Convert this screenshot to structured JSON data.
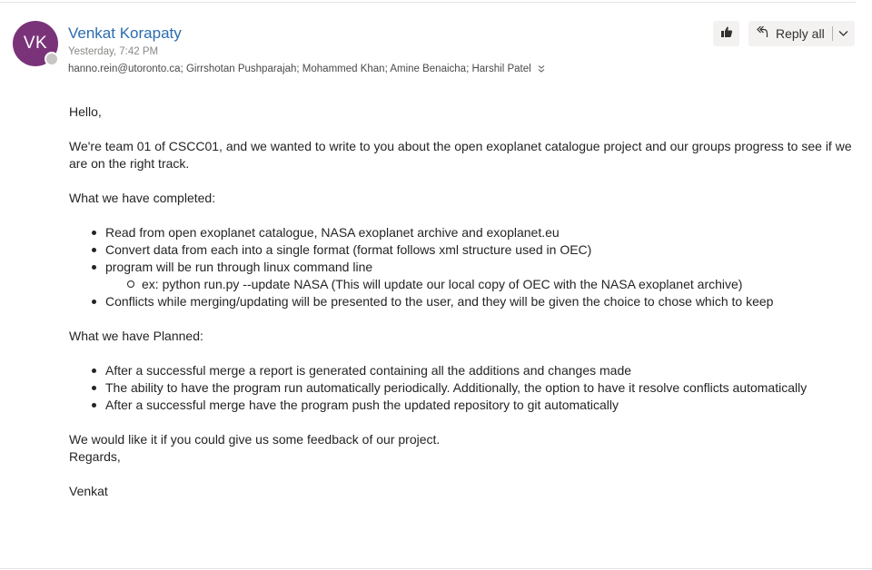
{
  "sender": {
    "initials": "VK",
    "name": "Venkat Korapaty",
    "timestamp": "Yesterday, 7:42 PM",
    "avatar_color": "#7a3379"
  },
  "recipients": "hanno.rein@utoronto.ca; Girrshotan Pushparajah; Mohammed Khan; Amine Benaicha; Harshil Patel",
  "actions": {
    "like_icon": "thumbs-up-icon",
    "reply_all_label": "Reply all",
    "reply_all_icon": "reply-all-icon",
    "dropdown_icon": "chevron-down-icon"
  },
  "body": {
    "greeting": "Hello,",
    "intro": "We're team 01 of CSCC01, and we wanted to write to you about the open exoplanet catalogue project and our groups progress to see if we are on the right track.",
    "completed_heading": "What we have completed:",
    "completed": [
      "Read from open exoplanet catalogue, NASA exoplanet archive and exoplanet.eu",
      "Convert data from each into a single format (format follows xml structure used in OEC)",
      "program will be run through linux command line",
      "Conflicts while merging/updating will be presented to the user, and they will be given the choice to chose which to keep"
    ],
    "completed_sub": "ex: python run.py --update NASA (This will update our local copy of OEC with the NASA exoplanet archive)",
    "planned_heading": "What we have Planned:",
    "planned": [
      "After a successful merge a report is generated containing all the additions and changes made",
      "The ability to have the program run automatically periodically. Additionally, the option to have it resolve conflicts automatically",
      "After a successful merge have the program push the updated repository to git automatically"
    ],
    "closing": "We would like it if you could give us some feedback of our project.",
    "regards": "Regards,",
    "signature": "Venkat"
  }
}
